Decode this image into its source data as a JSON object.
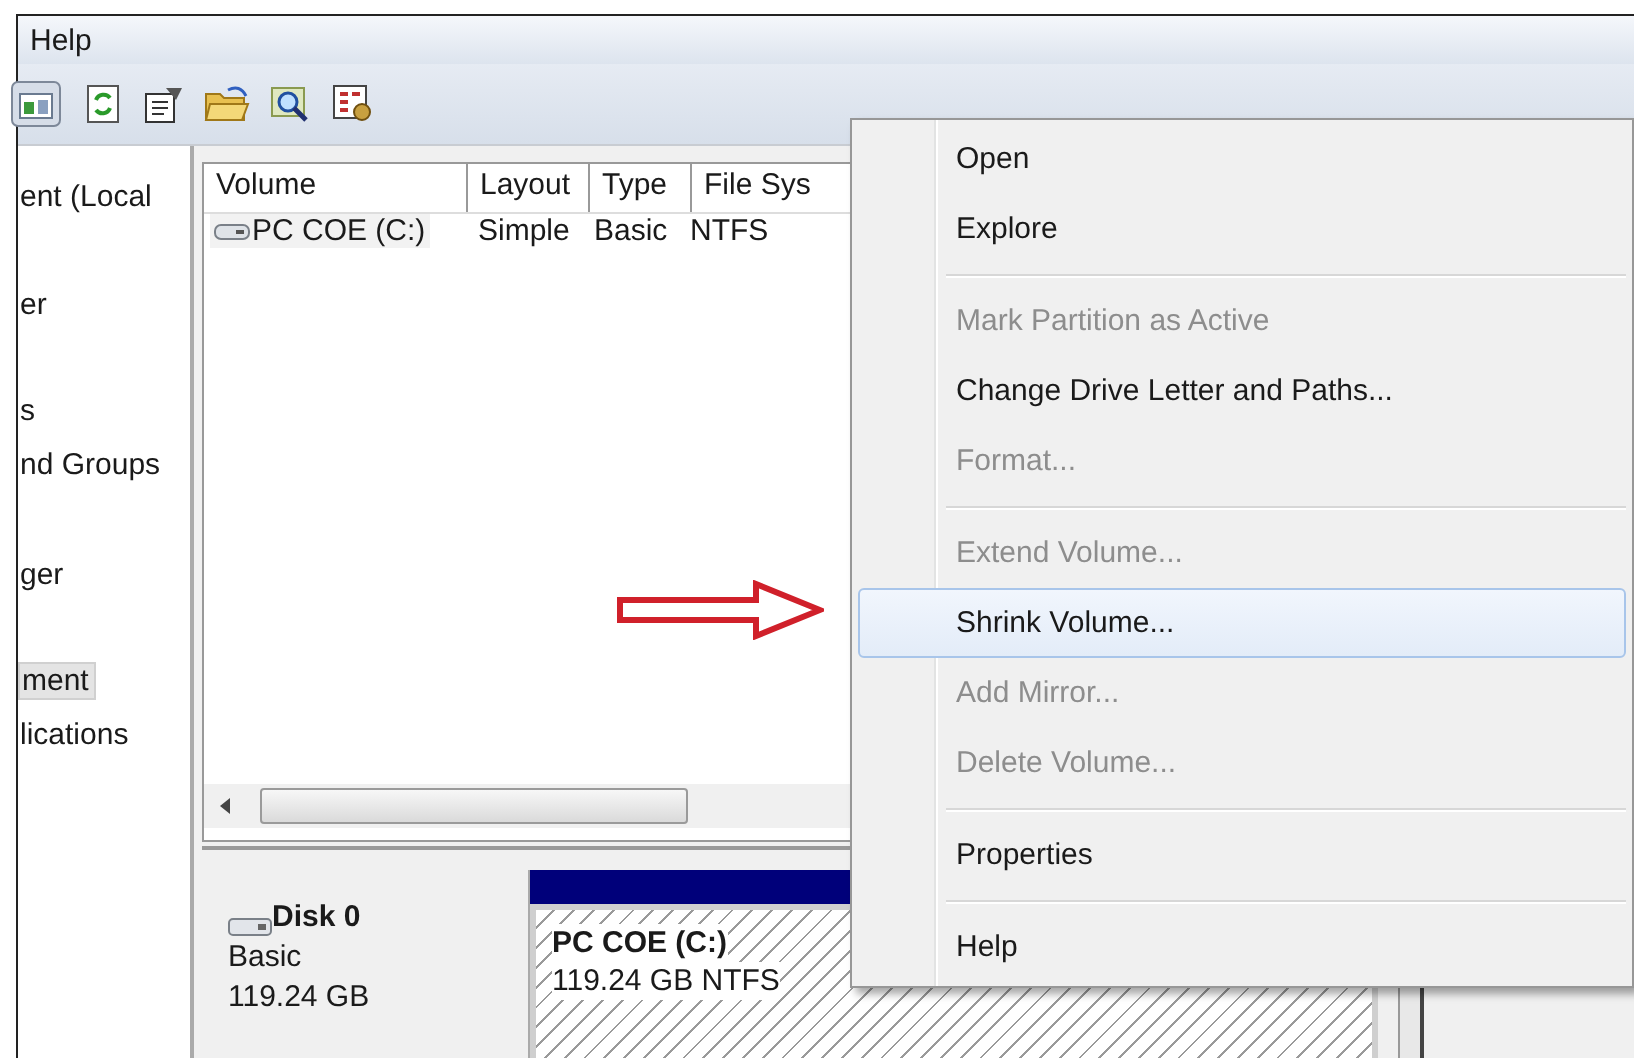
{
  "menu_bar": [
    {
      "label": "Help"
    }
  ],
  "nav_tree": [
    {
      "label": "ent (Local",
      "selected": false
    },
    {
      "label": "er",
      "selected": false
    },
    {
      "label": "s",
      "selected": false
    },
    {
      "label": "nd Groups",
      "selected": false
    },
    {
      "label": "ger",
      "selected": false
    },
    {
      "label": "ment",
      "selected": true
    },
    {
      "label": "lications",
      "selected": false
    }
  ],
  "volume_table": {
    "columns": [
      "Volume",
      "Layout",
      "Type",
      "File Sys"
    ],
    "rows": [
      {
        "cells": [
          "PC COE (C:)",
          "Simple",
          "Basic",
          "NTFS"
        ],
        "selected": true
      }
    ]
  },
  "disk": {
    "name": "Disk 0",
    "type": "Basic",
    "size": "119.24 GB",
    "partition": {
      "name": "PC COE  (C:)",
      "detail": "119.24 GB NTFS"
    }
  },
  "context_menu": [
    {
      "kind": "item",
      "label": "Open",
      "disabled": false,
      "selected": false
    },
    {
      "kind": "item",
      "label": "Explore",
      "disabled": false,
      "selected": false
    },
    {
      "kind": "separator"
    },
    {
      "kind": "item",
      "label": "Mark Partition as Active",
      "disabled": true,
      "selected": false
    },
    {
      "kind": "item",
      "label": "Change Drive Letter and Paths...",
      "disabled": false,
      "selected": false
    },
    {
      "kind": "item",
      "label": "Format...",
      "disabled": true,
      "selected": false
    },
    {
      "kind": "separator"
    },
    {
      "kind": "item",
      "label": "Extend Volume...",
      "disabled": true,
      "selected": false
    },
    {
      "kind": "item",
      "label": "Shrink Volume...",
      "disabled": false,
      "selected": true
    },
    {
      "kind": "item",
      "label": "Add Mirror...",
      "disabled": true,
      "selected": false
    },
    {
      "kind": "item",
      "label": "Delete Volume...",
      "disabled": true,
      "selected": false
    },
    {
      "kind": "separator"
    },
    {
      "kind": "item",
      "label": "Properties",
      "disabled": false,
      "selected": false
    },
    {
      "kind": "separator"
    },
    {
      "kind": "item",
      "label": "Help",
      "disabled": false,
      "selected": false
    }
  ]
}
